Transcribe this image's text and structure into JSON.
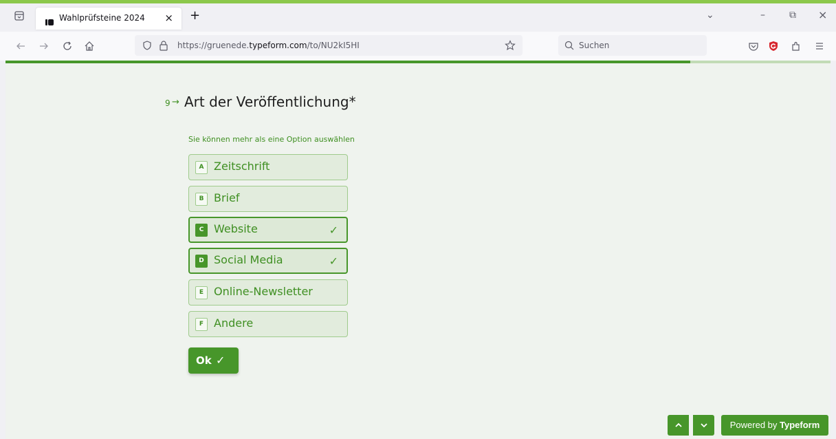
{
  "browser": {
    "tab_title": "Wahlprüfsteine 2024",
    "tab_close": "×",
    "new_tab": "+",
    "url_prefix": "https://gruenede.",
    "url_domain": "typeform.com",
    "url_suffix": "/to/NU2kI5HI",
    "search_placeholder": "Suchen",
    "window_controls": {
      "minimize": "–",
      "restore": "⧉",
      "close": "×",
      "list_all": "⌄"
    }
  },
  "form": {
    "question_number": "9",
    "question_arrow": "→",
    "question_title": "Art der Veröffentlichung*",
    "hint": "Sie können mehr als eine Option auswählen",
    "progress": 0.83,
    "options": [
      {
        "key": "A",
        "label": "Zeitschrift",
        "selected": false
      },
      {
        "key": "B",
        "label": "Brief",
        "selected": false
      },
      {
        "key": "C",
        "label": "Website",
        "selected": true
      },
      {
        "key": "D",
        "label": "Social Media",
        "selected": true
      },
      {
        "key": "E",
        "label": "Online-Newsletter",
        "selected": false
      },
      {
        "key": "F",
        "label": "Andere",
        "selected": false
      }
    ],
    "check_glyph": "✓",
    "ok_label": "Ok",
    "ok_check": "✓"
  },
  "footer": {
    "up_glyph": "⌃",
    "down_glyph": "⌄",
    "powered_prefix": "Powered by ",
    "powered_brand": "Typeform"
  },
  "colors": {
    "accent": "#47962a",
    "page_background": "#eff3ee",
    "frame": "#8cc84b"
  }
}
